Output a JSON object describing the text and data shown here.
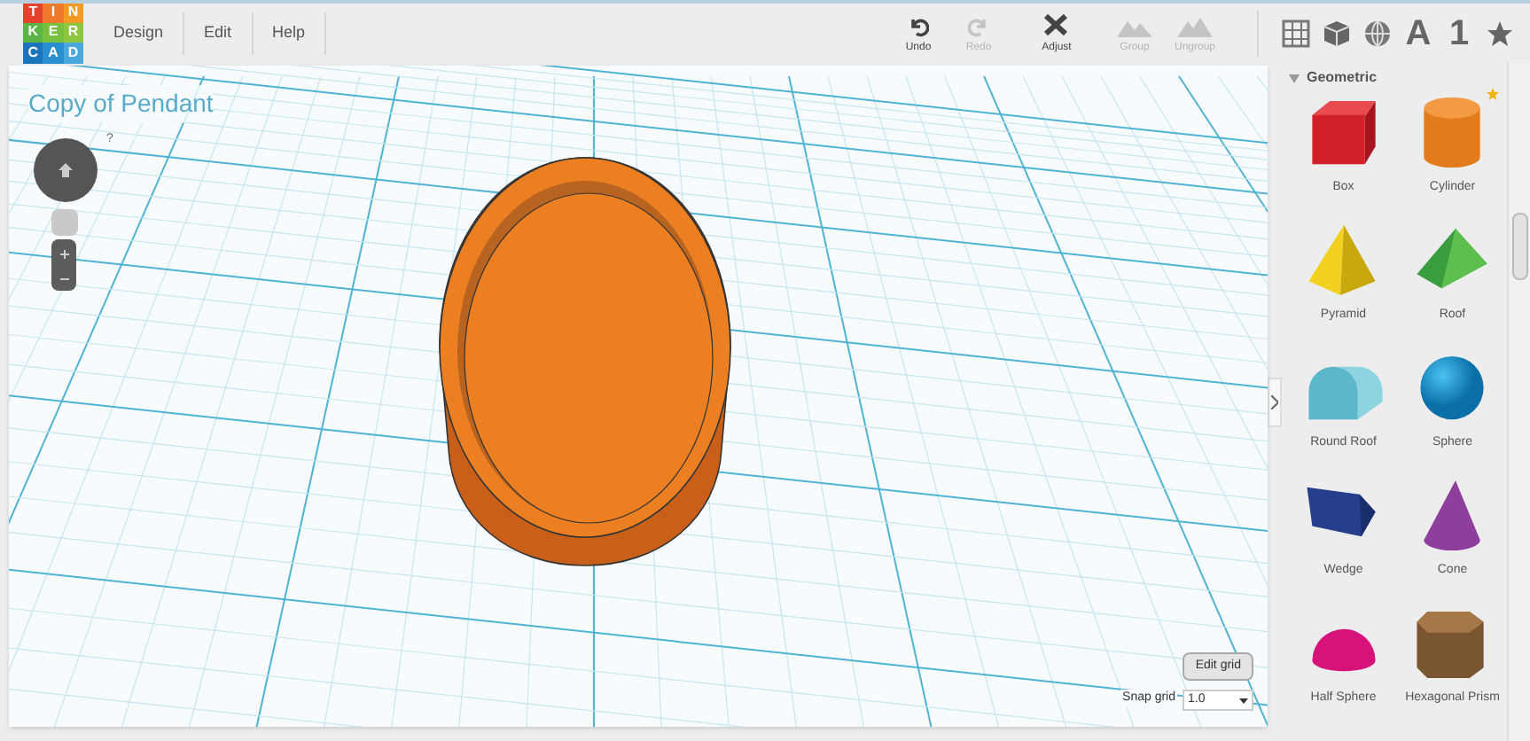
{
  "logo": [
    {
      "letter": "T",
      "color": "#e5412b"
    },
    {
      "letter": "I",
      "color": "#f07a2b"
    },
    {
      "letter": "N",
      "color": "#f39a25"
    },
    {
      "letter": "K",
      "color": "#5bb544"
    },
    {
      "letter": "E",
      "color": "#77bf3e"
    },
    {
      "letter": "R",
      "color": "#8dc63f"
    },
    {
      "letter": "C",
      "color": "#1b75bb"
    },
    {
      "letter": "A",
      "color": "#2a8fd0"
    },
    {
      "letter": "D",
      "color": "#4aa8de"
    }
  ],
  "menu": [
    "Design",
    "Edit",
    "Help"
  ],
  "toolbar": [
    {
      "kind": "undo",
      "label": "Undo",
      "disabled": false
    },
    {
      "kind": "redo",
      "label": "Redo",
      "disabled": true
    },
    {
      "kind": "adjust",
      "label": "Adjust",
      "disabled": false
    },
    {
      "kind": "group",
      "label": "Group",
      "disabled": true
    },
    {
      "kind": "ungroup",
      "label": "Ungroup",
      "disabled": true
    }
  ],
  "view_tabs": [
    {
      "kind": "grid"
    },
    {
      "kind": "cube"
    },
    {
      "kind": "globe"
    },
    {
      "kind": "text",
      "label": "A"
    },
    {
      "kind": "text",
      "label": "1"
    },
    {
      "kind": "star"
    }
  ],
  "design_title": "Copy of Pendant",
  "help_mark": "?",
  "grid_controls": {
    "button": "Edit grid",
    "snap_label": "Snap grid",
    "snap_value": "1.0"
  },
  "sidebar": {
    "section": "Geometric",
    "expanded": true,
    "items": [
      {
        "kind": "box",
        "label": "Box",
        "starred": false
      },
      {
        "kind": "cylinder",
        "label": "Cylinder",
        "starred": true
      },
      {
        "kind": "pyramid",
        "label": "Pyramid",
        "starred": false
      },
      {
        "kind": "roof",
        "label": "Roof",
        "starred": false
      },
      {
        "kind": "roundroof",
        "label": "Round Roof",
        "starred": false
      },
      {
        "kind": "sphere",
        "label": "Sphere",
        "starred": false
      },
      {
        "kind": "wedge",
        "label": "Wedge",
        "starred": false
      },
      {
        "kind": "cone",
        "label": "Cone",
        "starred": false
      },
      {
        "kind": "halfsphere",
        "label": "Half Sphere",
        "starred": false
      },
      {
        "kind": "hexprism",
        "label": "Hexagonal Prism",
        "starred": false
      }
    ]
  }
}
